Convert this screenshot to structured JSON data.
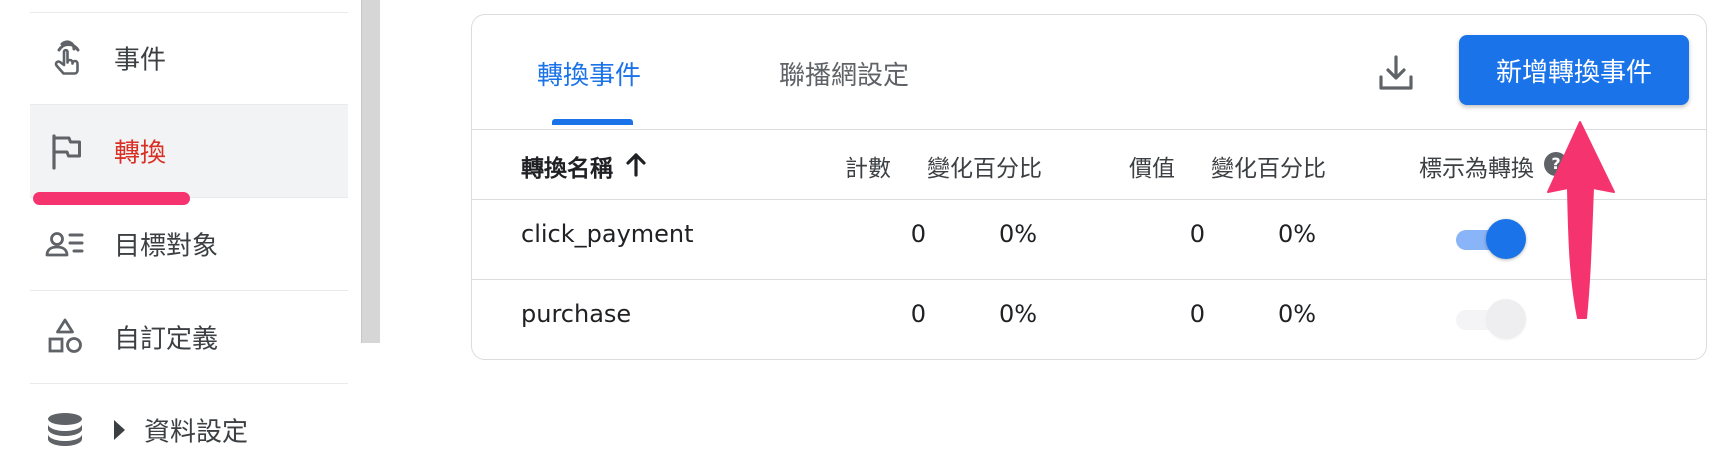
{
  "sidebar": {
    "items": [
      {
        "label": "事件",
        "icon": "touch-icon",
        "active": false
      },
      {
        "label": "轉換",
        "icon": "flag-icon",
        "active": true
      },
      {
        "label": "目標對象",
        "icon": "audience-icon",
        "active": false
      },
      {
        "label": "自訂定義",
        "icon": "shapes-icon",
        "active": false
      },
      {
        "label": "資料設定",
        "icon": "database-icon",
        "active": false,
        "expandable": true
      }
    ]
  },
  "card": {
    "tabs": [
      {
        "label": "轉換事件",
        "active": true
      },
      {
        "label": "聯播網設定",
        "active": false
      }
    ],
    "download_icon": "download-icon",
    "primary_button_label": "新增轉換事件",
    "table": {
      "headers": {
        "name": "轉換名稱",
        "count": "計數",
        "count_change": "變化百分比",
        "value": "價值",
        "value_change": "變化百分比",
        "mark": "標示為轉換"
      },
      "sort": "ascending",
      "rows": [
        {
          "name": "click_payment",
          "count": "0",
          "count_change": "0%",
          "value": "0",
          "value_change": "0%",
          "marked": true
        },
        {
          "name": "purchase",
          "count": "0",
          "count_change": "0%",
          "value": "0",
          "value_change": "0%",
          "marked": false
        }
      ]
    }
  },
  "colors": {
    "primary": "#1a73e8",
    "active_nav_text": "#d93025",
    "annotation_pink": "#f5346f"
  }
}
